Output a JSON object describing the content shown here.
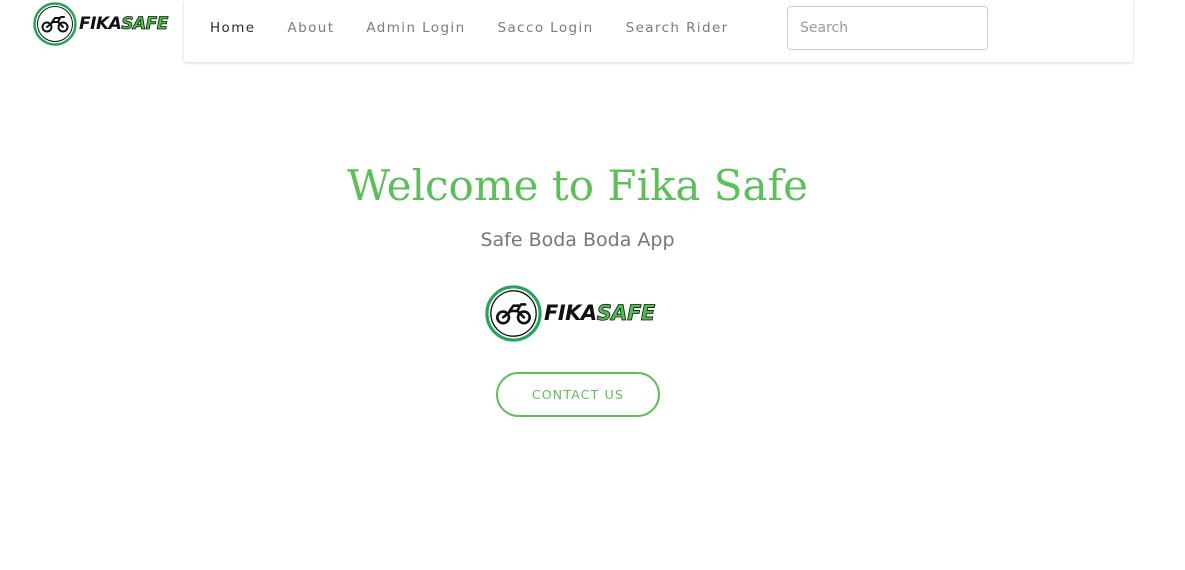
{
  "brand": {
    "logo_text_dark": "FIKA",
    "logo_text_green": "SAFE",
    "colors": {
      "accent": "#5cbf5a",
      "logo_ring": "#27a35a",
      "nav_text": "#7b7b7b",
      "nav_active": "#2b2b2b",
      "subtitle": "#777777"
    }
  },
  "nav": {
    "items": [
      {
        "label": "Home",
        "active": true
      },
      {
        "label": "About",
        "active": false
      },
      {
        "label": "Admin Login",
        "active": false
      },
      {
        "label": "Sacco Login",
        "active": false
      },
      {
        "label": "Search Rider",
        "active": false
      }
    ],
    "search": {
      "placeholder": "Search",
      "value": ""
    }
  },
  "hero": {
    "title": "Welcome to Fika Safe",
    "subtitle": "Safe Boda Boda App",
    "contact_button": "CONTACT US"
  },
  "icons": {
    "logo_emblem": "motorbike-icon"
  }
}
